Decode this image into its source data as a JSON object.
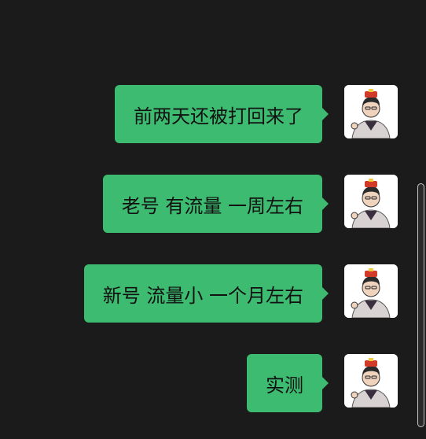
{
  "messages": [
    {
      "text": "前两天还被打回来了",
      "avatar": "avatar-image"
    },
    {
      "text": "老号 有流量 一周左右",
      "avatar": "avatar-image"
    },
    {
      "text": "新号 流量小 一个月左右",
      "avatar": "avatar-image"
    },
    {
      "text": "实测",
      "avatar": "avatar-image"
    }
  ],
  "colors": {
    "background": "#1b1b1b",
    "bubble": "#3dbb71",
    "text": "#111111"
  }
}
